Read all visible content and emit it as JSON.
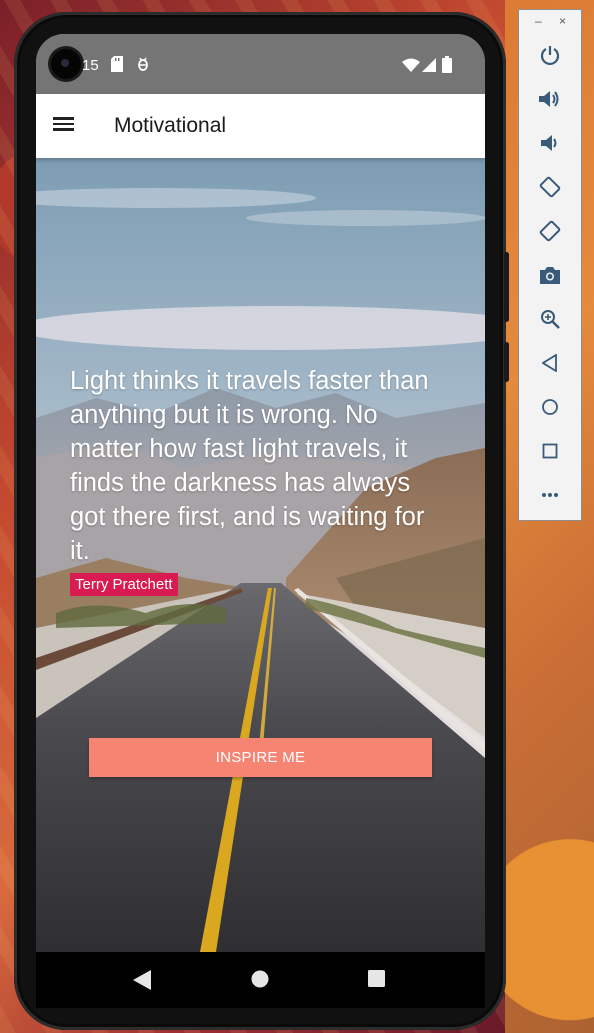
{
  "status_bar": {
    "time": "15"
  },
  "app_bar": {
    "title": "Motivational",
    "menu_icon": "hamburger-menu-icon"
  },
  "quote": {
    "text": "Light thinks it travels faster than anything but it is wrong. No matter how fast light travels, it finds the darkness has always got there first, and is waiting for it.",
    "author": "Terry Pratchett"
  },
  "actions": {
    "inspire_label": "INSPIRE ME"
  },
  "emulator_panel": {
    "minimize": "–",
    "close": "×",
    "buttons": [
      "power-icon",
      "volume-up-icon",
      "volume-down-icon",
      "rotate-left-icon",
      "rotate-right-icon",
      "camera-icon",
      "zoom-icon",
      "back-icon",
      "home-icon",
      "overview-icon",
      "more-icon"
    ]
  },
  "colors": {
    "accent_button": "#f58473",
    "author_badge": "#d81b50",
    "status_bar": "#757575"
  }
}
